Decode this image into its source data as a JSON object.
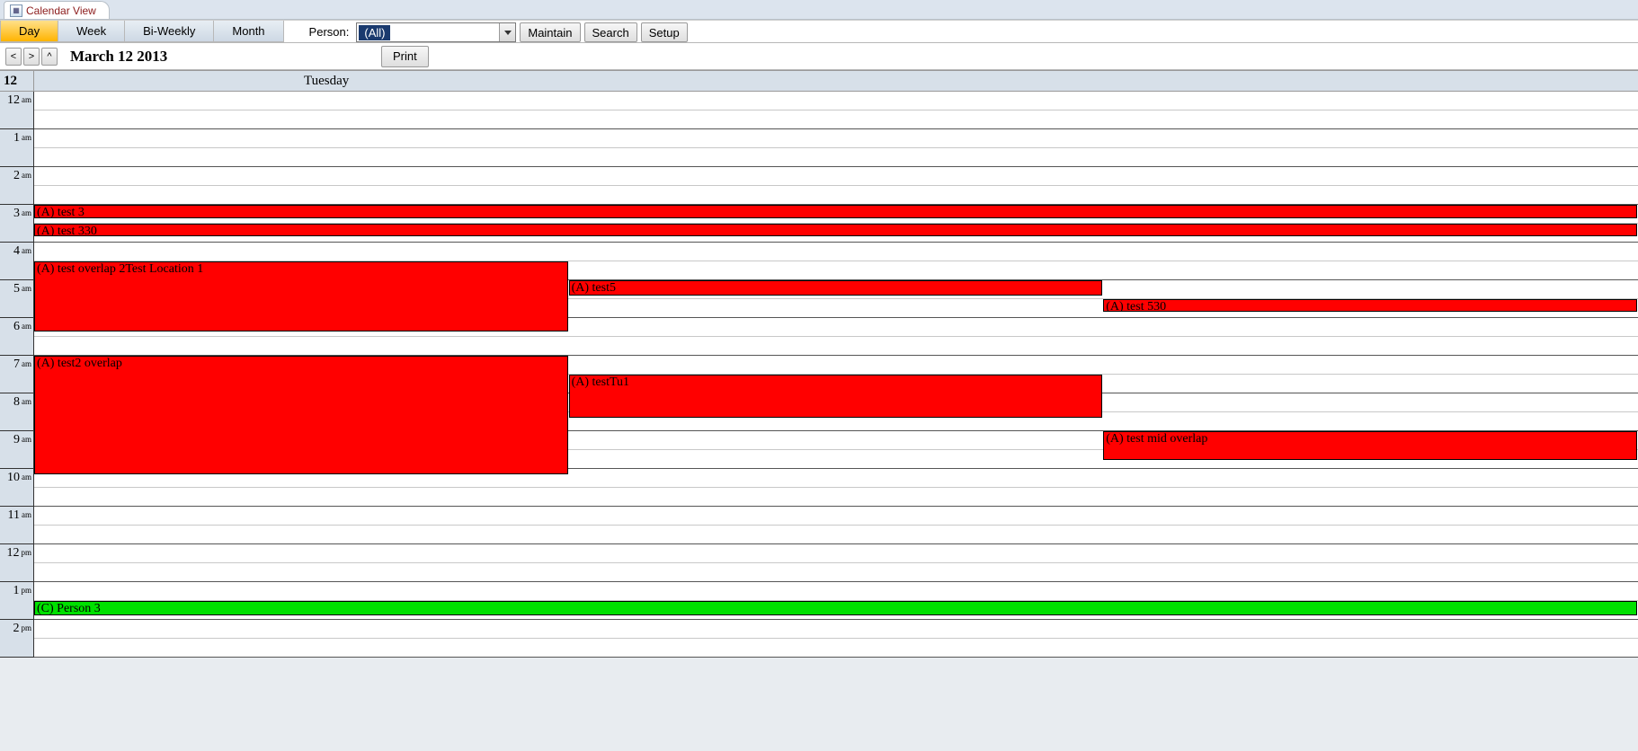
{
  "window": {
    "tab_title": "Calendar View"
  },
  "toolbar": {
    "view_day": "Day",
    "view_week": "Week",
    "view_biweekly": "Bi-Weekly",
    "view_month": "Month",
    "person_label": "Person:",
    "person_value": "(All)",
    "maintain": "Maintain",
    "search": "Search",
    "setup": "Setup"
  },
  "nav": {
    "prev": "<",
    "next": ">",
    "today": "^",
    "date_title": "March 12 2013",
    "print": "Print"
  },
  "dayheader": {
    "number": "12",
    "name": "Tuesday"
  },
  "hours": [
    {
      "num": "12",
      "ampm": "am"
    },
    {
      "num": "1",
      "ampm": "am"
    },
    {
      "num": "2",
      "ampm": "am"
    },
    {
      "num": "3",
      "ampm": "am"
    },
    {
      "num": "4",
      "ampm": "am"
    },
    {
      "num": "5",
      "ampm": "am"
    },
    {
      "num": "6",
      "ampm": "am"
    },
    {
      "num": "7",
      "ampm": "am"
    },
    {
      "num": "8",
      "ampm": "am"
    },
    {
      "num": "9",
      "ampm": "am"
    },
    {
      "num": "10",
      "ampm": "am"
    },
    {
      "num": "11",
      "ampm": "am"
    },
    {
      "num": "12",
      "ampm": "pm"
    },
    {
      "num": "1",
      "ampm": "pm"
    },
    {
      "num": "2",
      "ampm": "pm"
    }
  ],
  "events": {
    "e0": {
      "label": "(A) test 3",
      "topSlot": 6,
      "heightSlots": 0.8,
      "leftPct": 0,
      "widthPct": 100,
      "color": "red"
    },
    "e1": {
      "label": "(A) test 330",
      "topSlot": 7,
      "heightSlots": 0.7,
      "leftPct": 0,
      "widthPct": 100,
      "color": "red"
    },
    "e2": {
      "label": "(A) test overlap 2Test Location 1",
      "topSlot": 9,
      "heightSlots": 3.8,
      "leftPct": 0,
      "widthPct": 33.33,
      "color": "red"
    },
    "e3": {
      "label": "(A) test5",
      "topSlot": 10,
      "heightSlots": 0.9,
      "leftPct": 33.33,
      "widthPct": 33.33,
      "color": "red"
    },
    "e4": {
      "label": "(A) test 530",
      "topSlot": 11,
      "heightSlots": 0.7,
      "leftPct": 66.66,
      "widthPct": 33.34,
      "color": "red"
    },
    "e5": {
      "label": "(A) test2 overlap",
      "topSlot": 14,
      "heightSlots": 6.4,
      "leftPct": 0,
      "widthPct": 33.33,
      "color": "red"
    },
    "e6": {
      "label": "(A) testTu1",
      "topSlot": 15,
      "heightSlots": 2.4,
      "leftPct": 33.33,
      "widthPct": 33.33,
      "color": "red"
    },
    "e7": {
      "label": "(A) test mid overlap",
      "topSlot": 18,
      "heightSlots": 1.6,
      "leftPct": 66.66,
      "widthPct": 33.34,
      "color": "red"
    },
    "e8": {
      "label": "(C) Person 3",
      "topSlot": 27,
      "heightSlots": 0.85,
      "leftPct": 0,
      "widthPct": 100,
      "color": "green"
    }
  }
}
